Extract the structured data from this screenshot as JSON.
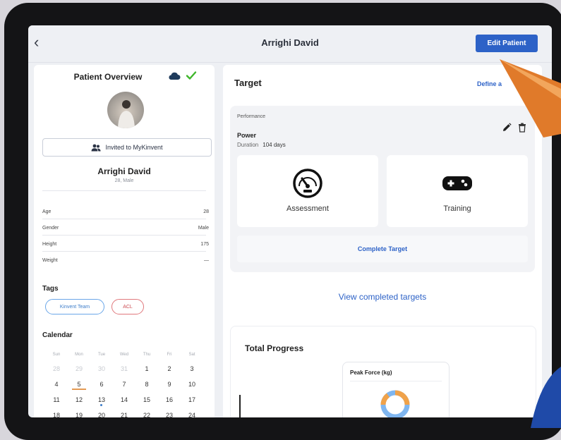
{
  "nav": {
    "title": "Arrighi David",
    "edit_label": "Edit Patient"
  },
  "overview": {
    "title": "Patient Overview",
    "invite_label": "Invited to MyKinvent",
    "name": "Arrighi David",
    "subtitle": "28, Male",
    "rows": [
      {
        "label": "Age",
        "value": "28"
      },
      {
        "label": "Gender",
        "value": "Male"
      },
      {
        "label": "Height",
        "value": "175"
      },
      {
        "label": "Weight",
        "value": "—"
      }
    ]
  },
  "tags": {
    "title": "Tags",
    "items": [
      "Kinvent Team",
      "ACL"
    ]
  },
  "calendar": {
    "title": "Calendar",
    "weekdays": [
      "Sun",
      "Mon",
      "Tue",
      "Wed",
      "Thu",
      "Fri",
      "Sat"
    ],
    "weeks": [
      [
        "28",
        "29",
        "30",
        "31",
        "1",
        "2",
        "3"
      ],
      [
        "4",
        "5",
        "6",
        "7",
        "8",
        "9",
        "10"
      ],
      [
        "11",
        "12",
        "13",
        "14",
        "15",
        "16",
        "17"
      ],
      [
        "18",
        "19",
        "20",
        "21",
        "22",
        "23",
        "24"
      ]
    ]
  },
  "target": {
    "title": "Target",
    "define_label": "Define a",
    "category": "Performance",
    "name": "Power",
    "duration_label": "Duration",
    "duration_value": "104 days",
    "options": [
      {
        "label": "Assessment",
        "icon": "gauge-icon"
      },
      {
        "label": "Training",
        "icon": "gamepad-icon"
      }
    ],
    "complete_label": "Complete Target",
    "view_completed_label": "View completed targets"
  },
  "progress": {
    "title": "Total Progress",
    "card_title": "Peak Force (kg)"
  },
  "colors": {
    "primary": "#2d62c7",
    "success": "#3fb62b",
    "tag_blue": "#6aa6e8",
    "tag_red": "#e0787c",
    "donut_blue": "#7fb6f0",
    "donut_orange": "#f0a24a"
  }
}
